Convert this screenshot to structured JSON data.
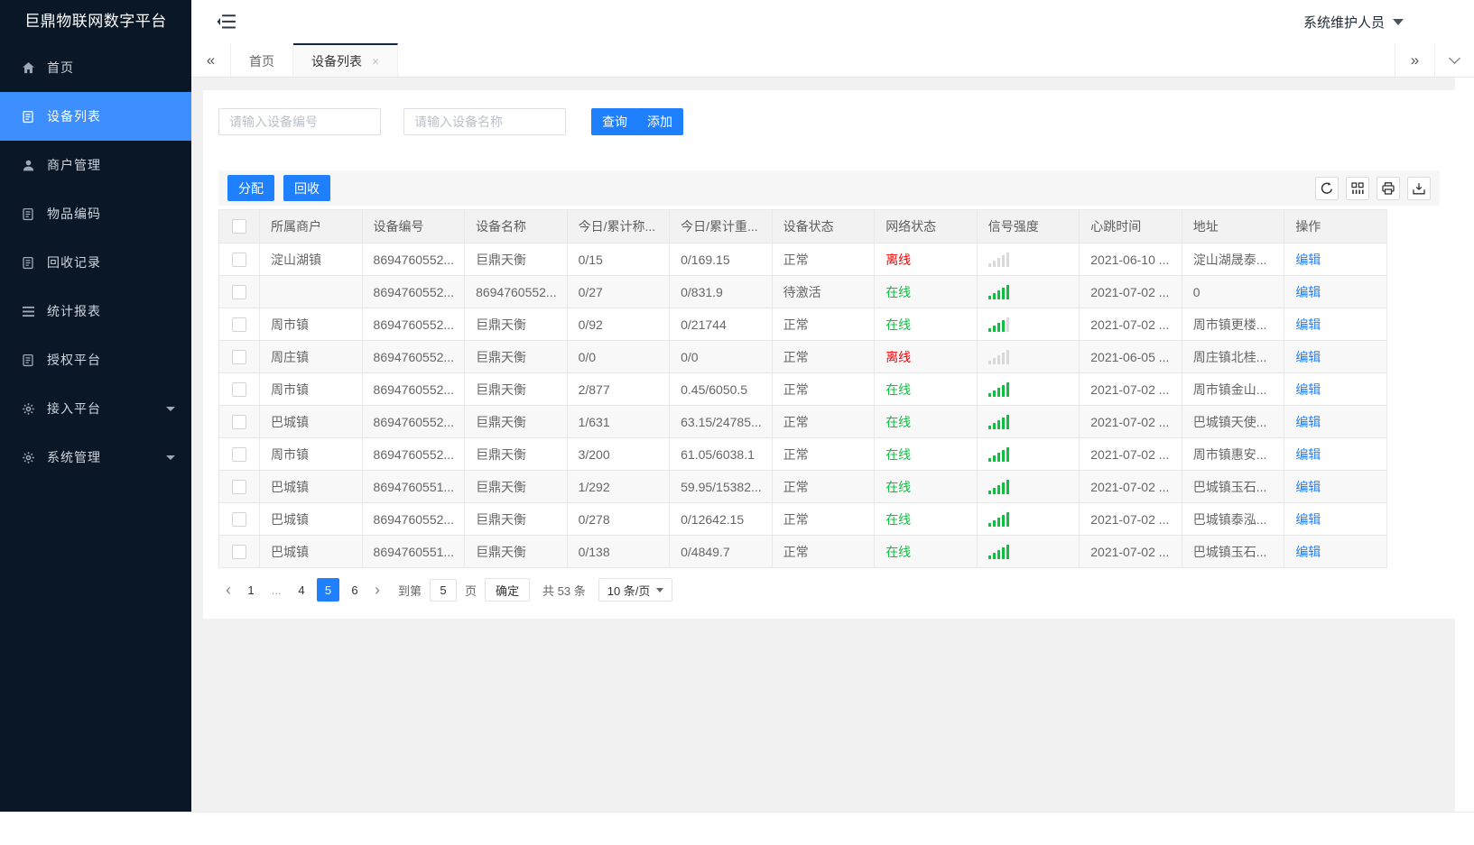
{
  "app": {
    "logo_title": "巨鼎物联网数字平台",
    "user_name": "系统维护人员"
  },
  "sidebar": {
    "items": [
      {
        "id": "home",
        "label": "首页",
        "icon": "home-icon",
        "active": false,
        "caret": false
      },
      {
        "id": "device-list",
        "label": "设备列表",
        "icon": "doc-icon",
        "active": true,
        "caret": false
      },
      {
        "id": "merchant-mgmt",
        "label": "商户管理",
        "icon": "user-icon",
        "active": false,
        "caret": false
      },
      {
        "id": "item-code",
        "label": "物品编码",
        "icon": "doc-icon",
        "active": false,
        "caret": false
      },
      {
        "id": "recycle-record",
        "label": "回收记录",
        "icon": "doc-icon",
        "active": false,
        "caret": false
      },
      {
        "id": "stats-report",
        "label": "统计报表",
        "icon": "lines-icon",
        "active": false,
        "caret": false
      },
      {
        "id": "auth-platform",
        "label": "授权平台",
        "icon": "doc-icon",
        "active": false,
        "caret": false
      },
      {
        "id": "access-platform",
        "label": "接入平台",
        "icon": "gear-icon",
        "active": false,
        "caret": true
      },
      {
        "id": "system-mgmt",
        "label": "系统管理",
        "icon": "gear-icon",
        "active": false,
        "caret": true
      }
    ]
  },
  "tabs": {
    "items": [
      {
        "id": "home",
        "label": "首页",
        "active": false,
        "closable": false
      },
      {
        "id": "device-list",
        "label": "设备列表",
        "active": true,
        "closable": true
      }
    ]
  },
  "search": {
    "device_no_placeholder": "请输入设备编号",
    "device_name_placeholder": "请输入设备名称",
    "query_label": "查询",
    "add_label": "添加"
  },
  "toolbar": {
    "assign_label": "分配",
    "recycle_label": "回收",
    "icons": [
      "refresh-icon",
      "columns-icon",
      "print-icon",
      "export-icon"
    ]
  },
  "table": {
    "columns": [
      "所属商户",
      "设备编号",
      "设备名称",
      "今日/累计称...",
      "今日/累计重...",
      "设备状态",
      "网络状态",
      "信号强度",
      "心跳时间",
      "地址",
      "操作"
    ],
    "rows": [
      {
        "merchant": "淀山湖镇",
        "device_no": "8694760552...",
        "device_name": "巨鼎天衡",
        "count": "0/15",
        "weight": "0/169.15",
        "status": "正常",
        "network": "离线",
        "online": false,
        "signal": 0,
        "heartbeat": "2021-06-10 ...",
        "address": "淀山湖晟泰...",
        "action": "编辑"
      },
      {
        "merchant": "",
        "device_no": "8694760552...",
        "device_name": "8694760552...",
        "count": "0/27",
        "weight": "0/831.9",
        "status": "待激活",
        "network": "在线",
        "online": true,
        "signal": 5,
        "heartbeat": "2021-07-02 ...",
        "address": "0",
        "action": "编辑"
      },
      {
        "merchant": "周市镇",
        "device_no": "8694760552...",
        "device_name": "巨鼎天衡",
        "count": "0/92",
        "weight": "0/21744",
        "status": "正常",
        "network": "在线",
        "online": true,
        "signal": 4,
        "heartbeat": "2021-07-02 ...",
        "address": "周市镇更楼...",
        "action": "编辑"
      },
      {
        "merchant": "周庄镇",
        "device_no": "8694760552...",
        "device_name": "巨鼎天衡",
        "count": "0/0",
        "weight": "0/0",
        "status": "正常",
        "network": "离线",
        "online": false,
        "signal": 0,
        "heartbeat": "2021-06-05 ...",
        "address": "周庄镇北桂...",
        "action": "编辑"
      },
      {
        "merchant": "周市镇",
        "device_no": "8694760552...",
        "device_name": "巨鼎天衡",
        "count": "2/877",
        "weight": "0.45/6050.5",
        "status": "正常",
        "network": "在线",
        "online": true,
        "signal": 5,
        "heartbeat": "2021-07-02 ...",
        "address": "周市镇金山...",
        "action": "编辑"
      },
      {
        "merchant": "巴城镇",
        "device_no": "8694760552...",
        "device_name": "巨鼎天衡",
        "count": "1/631",
        "weight": "63.15/24785...",
        "status": "正常",
        "network": "在线",
        "online": true,
        "signal": 5,
        "heartbeat": "2021-07-02 ...",
        "address": "巴城镇天使...",
        "action": "编辑"
      },
      {
        "merchant": "周市镇",
        "device_no": "8694760552...",
        "device_name": "巨鼎天衡",
        "count": "3/200",
        "weight": "61.05/6038.1",
        "status": "正常",
        "network": "在线",
        "online": true,
        "signal": 5,
        "heartbeat": "2021-07-02 ...",
        "address": "周市镇惠安...",
        "action": "编辑"
      },
      {
        "merchant": "巴城镇",
        "device_no": "8694760551...",
        "device_name": "巨鼎天衡",
        "count": "1/292",
        "weight": "59.95/15382...",
        "status": "正常",
        "network": "在线",
        "online": true,
        "signal": 5,
        "heartbeat": "2021-07-02 ...",
        "address": "巴城镇玉石...",
        "action": "编辑"
      },
      {
        "merchant": "巴城镇",
        "device_no": "8694760552...",
        "device_name": "巨鼎天衡",
        "count": "0/278",
        "weight": "0/12642.15",
        "status": "正常",
        "network": "在线",
        "online": true,
        "signal": 5,
        "heartbeat": "2021-07-02 ...",
        "address": "巴城镇泰泓...",
        "action": "编辑"
      },
      {
        "merchant": "巴城镇",
        "device_no": "8694760551...",
        "device_name": "巨鼎天衡",
        "count": "0/138",
        "weight": "0/4849.7",
        "status": "正常",
        "network": "在线",
        "online": true,
        "signal": 5,
        "heartbeat": "2021-07-02 ...",
        "address": "巴城镇玉石...",
        "action": "编辑"
      }
    ]
  },
  "pagination": {
    "pages": [
      "1",
      "...",
      "4",
      "5",
      "6"
    ],
    "active_page": "5",
    "jump_label": "到第",
    "jump_value": "5",
    "page_unit": "页",
    "confirm_label": "确定",
    "total_label": "共 53 条",
    "page_size_label": "10 条/页"
  },
  "colors": {
    "accent_blue": "#1e80ff",
    "online_green": "#0fbf3f",
    "offline_red": "#ff0000",
    "sidebar_bg": "#0a1726",
    "sidebar_active": "#3d8eff",
    "active_tab_border": "#16243c"
  }
}
